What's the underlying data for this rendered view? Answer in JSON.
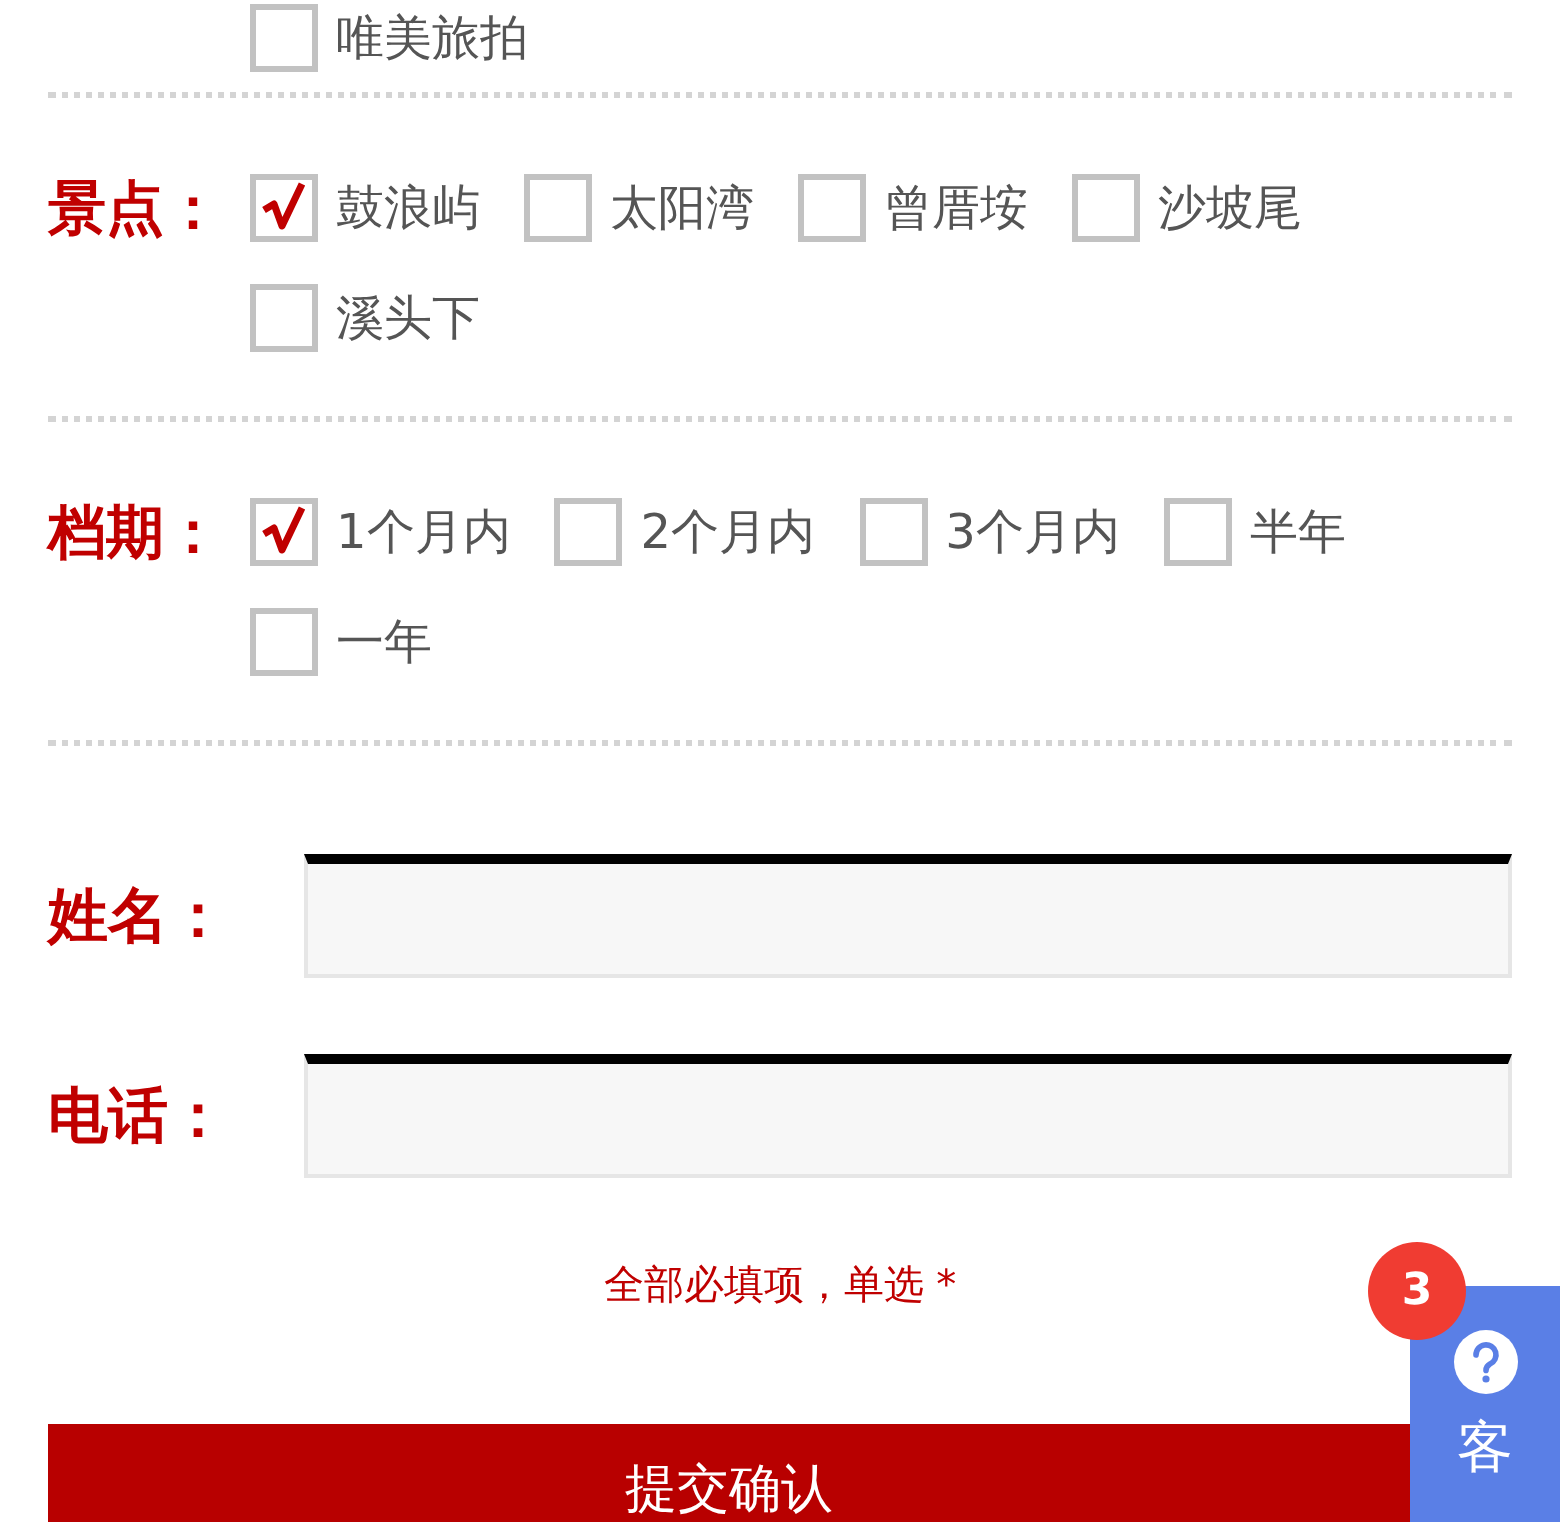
{
  "groups": [
    {
      "options": [
        {
          "text": "唯美旅拍",
          "checked": false
        }
      ]
    },
    {
      "label": "景点：",
      "options": [
        {
          "text": "鼓浪屿",
          "checked": true
        },
        {
          "text": "太阳湾",
          "checked": false
        },
        {
          "text": "曾厝垵",
          "checked": false
        },
        {
          "text": "沙坡尾",
          "checked": false
        },
        {
          "text": "溪头下",
          "checked": false
        }
      ]
    },
    {
      "label": "档期：",
      "options": [
        {
          "text": "1个月内",
          "checked": true
        },
        {
          "text": "2个月内",
          "checked": false
        },
        {
          "text": "3个月内",
          "checked": false
        },
        {
          "text": "半年",
          "checked": false
        },
        {
          "text": "一年",
          "checked": false
        }
      ]
    }
  ],
  "fields": [
    {
      "label": "姓名："
    },
    {
      "label": "电话："
    }
  ],
  "note": "全部必填项，单选 *",
  "submit": "提交确认",
  "service": {
    "badge": "3",
    "text": "客"
  }
}
